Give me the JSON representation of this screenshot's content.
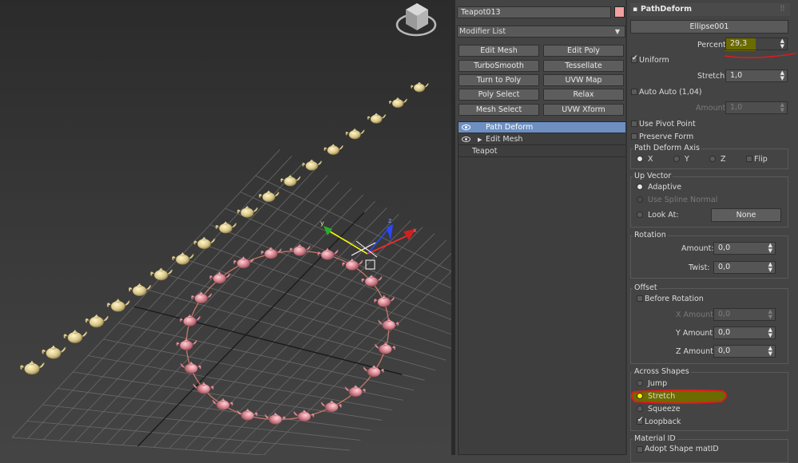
{
  "object_name": "Teapot013",
  "object_color": "#f2a0a0",
  "modifier_list": {
    "label": "Modifier List"
  },
  "modifier_buttons": [
    "Edit Mesh",
    "Edit Poly",
    "TurboSmooth",
    "Tessellate",
    "Turn to Poly",
    "UVW Map",
    "Poly Select",
    "Relax",
    "Mesh Select",
    "UVW Xform"
  ],
  "stack": {
    "items": [
      {
        "label": "Path Deform",
        "selected": true
      },
      {
        "label": "Edit Mesh",
        "selected": false
      },
      {
        "label": "Teapot",
        "selected": false
      }
    ]
  },
  "rollout": {
    "title": "PathDeform",
    "path_button": "Ellipse001",
    "percent": {
      "label": "Percent",
      "value": "29,3"
    },
    "uniform": {
      "label": "Uniform",
      "checked": true
    },
    "stretch": {
      "label": "Stretch:",
      "value": "1,0"
    },
    "auto": {
      "label": "Auto",
      "value_label": "Auto (1,04)",
      "checked": false
    },
    "amount": {
      "label": "Amount:",
      "value": "1,0"
    },
    "use_pivot_point": {
      "label": "Use Pivot Point",
      "checked": false
    },
    "preserve_form": {
      "label": "Preserve Form",
      "checked": false
    },
    "axis": {
      "title": "Path Deform Axis",
      "x": "X",
      "y": "Y",
      "z": "Z",
      "flip": "Flip",
      "selected": "X"
    },
    "up_vector": {
      "title": "Up Vector",
      "adaptive": "Adaptive",
      "use_spline_normal": "Use Spline Normal",
      "look_at": "Look At:",
      "none_button": "None",
      "selected": "Adaptive"
    },
    "rotation": {
      "title": "Rotation",
      "amount_label": "Amount:",
      "amount_value": "0,0",
      "twist_label": "Twist:",
      "twist_value": "0,0"
    },
    "offset": {
      "title": "Offset",
      "before_rotation": "Before Rotation",
      "x_label": "X Amount:",
      "x_value": "0,0",
      "y_label": "Y Amount:",
      "y_value": "0,0",
      "z_label": "Z Amount:",
      "z_value": "0,0"
    },
    "across_shapes": {
      "title": "Across Shapes",
      "jump": "Jump",
      "stretch": "Stretch",
      "squeeze": "Squeeze",
      "loopback": "Loopback",
      "selected": "Stretch",
      "loopback_checked": true
    },
    "material_id": {
      "title": "Material ID",
      "adopt": "Adopt Shape matID"
    }
  },
  "colors": {
    "selection_blue": "#6d8fc2",
    "teapot_pink": "#d98c97",
    "teapot_gold": "#e3d49a",
    "annotation_red": "#e01b1b",
    "highlight_yellow": "#6c6b00"
  }
}
